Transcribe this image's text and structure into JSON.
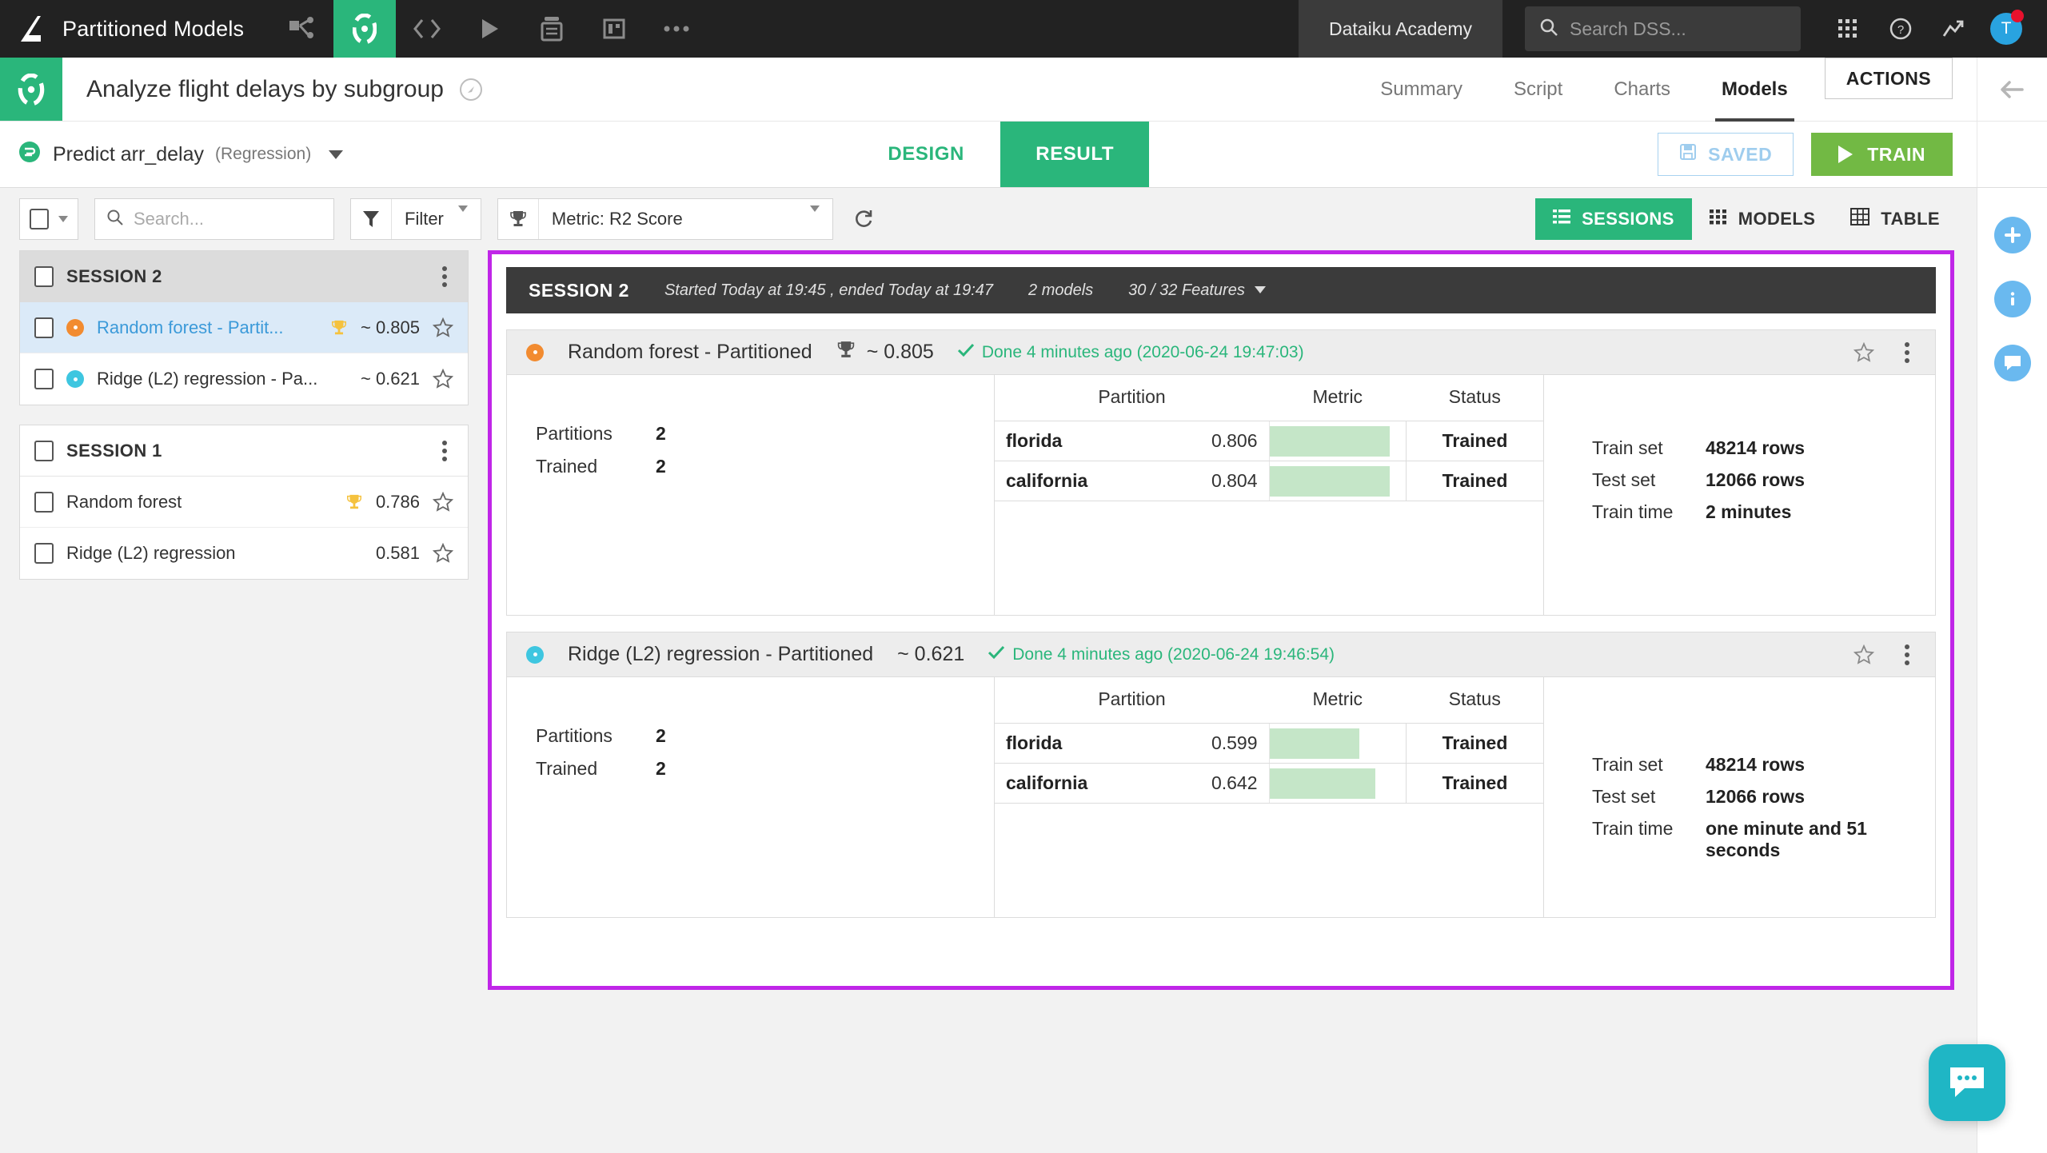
{
  "topbar": {
    "logo_icon": "dataiku-logo-icon",
    "project_name": "Partitioned Models",
    "nav_icons": [
      "flow-icon",
      "lab-icon",
      "code-icon",
      "jobs-icon",
      "notebooks-icon",
      "dashboards-icon",
      "more-icon"
    ],
    "academy_label": "Dataiku Academy",
    "search_placeholder": "Search DSS...",
    "apps_icon": "apps-grid-icon",
    "help_icon": "help-circle-icon",
    "monitoring_icon": "trending-up-icon",
    "avatar_initial": "T"
  },
  "project_header": {
    "logo_icon": "lab-circle-icon",
    "title": "Analyze flight delays by subgroup",
    "share_icon": "share-circle-icon",
    "tabs": [
      {
        "label": "Summary",
        "active": false
      },
      {
        "label": "Script",
        "active": false
      },
      {
        "label": "Charts",
        "active": false
      },
      {
        "label": "Models",
        "active": true
      }
    ],
    "actions_label": "ACTIONS",
    "collapse_icon": "arrow-left-icon"
  },
  "model_bar": {
    "icon": "prediction-icon",
    "name": "Predict arr_delay",
    "subtitle": "(Regression)",
    "dropdown_icon": "caret-down-icon",
    "tabs": [
      {
        "label": "DESIGN",
        "active": false
      },
      {
        "label": "RESULT",
        "active": true
      }
    ],
    "saved_label": "SAVED",
    "saved_icon": "floppy-disk-icon",
    "train_label": "TRAIN",
    "train_icon": "play-icon"
  },
  "toolbar": {
    "select_all_icon": "checkbox-icon",
    "select_all_caret": "caret-down-icon",
    "search_icon": "search-icon",
    "search_placeholder": "Search...",
    "filter_icon": "funnel-icon",
    "filter_label": "Filter",
    "filter_caret": "caret-down-icon",
    "metric_icon": "trophy-icon",
    "metric_label": "Metric: R2 Score",
    "metric_caret": "caret-down-icon",
    "refresh_icon": "refresh-icon",
    "views": [
      {
        "label": "SESSIONS",
        "icon": "list-icon",
        "active": true
      },
      {
        "label": "MODELS",
        "icon": "grid-icon",
        "active": false
      },
      {
        "label": "TABLE",
        "icon": "table-icon",
        "active": false
      }
    ]
  },
  "sidebar": {
    "groups": [
      {
        "title": "SESSION 2",
        "header_style": "dark",
        "kebab_icon": "kebab-menu-icon",
        "rows": [
          {
            "name": "Random forest - Partit...",
            "score": "~ 0.805",
            "dot_color": "#f28b30",
            "trophy": true,
            "selected": true,
            "star_icon": "star-outline-icon"
          },
          {
            "name": "Ridge (L2) regression - Pa...",
            "score": "~ 0.621",
            "dot_color": "#3ec6e0",
            "trophy": false,
            "selected": false,
            "star_icon": "star-outline-icon"
          }
        ]
      },
      {
        "title": "SESSION 1",
        "header_style": "light",
        "kebab_icon": "kebab-menu-icon",
        "rows": [
          {
            "name": "Random forest",
            "score": "0.786",
            "dot_color": null,
            "trophy": true,
            "selected": false,
            "star_icon": "star-outline-icon"
          },
          {
            "name": "Ridge (L2) regression",
            "score": "0.581",
            "dot_color": null,
            "trophy": false,
            "selected": false,
            "star_icon": "star-outline-icon"
          }
        ]
      }
    ]
  },
  "session_banner": {
    "title": "SESSION 2",
    "times": "Started Today at 19:45 , ended Today at 19:47",
    "models_count": "2 models",
    "features": "30 / 32 Features",
    "features_caret": "caret-down-icon"
  },
  "cards": [
    {
      "dot_color": "#f28b30",
      "name": "Random forest - Partitioned",
      "trophy": true,
      "trophy_icon": "trophy-icon",
      "score": "~ 0.805",
      "status_icon": "check-icon",
      "status": "Done 4 minutes ago (2020-06-24 19:47:03)",
      "star_icon": "star-outline-icon",
      "kebab_icon": "kebab-menu-icon",
      "summary": [
        {
          "label": "Partitions",
          "value": "2"
        },
        {
          "label": "Trained",
          "value": "2"
        }
      ],
      "table": {
        "columns": [
          "Partition",
          "Metric",
          "Status"
        ],
        "rows": [
          {
            "partition": "florida",
            "metric": "0.806",
            "bar_pct": 88,
            "status": "Trained"
          },
          {
            "partition": "california",
            "metric": "0.804",
            "bar_pct": 88,
            "status": "Trained"
          }
        ]
      },
      "info": [
        {
          "label": "Train set",
          "value": "48214 rows"
        },
        {
          "label": "Test set",
          "value": "12066 rows"
        },
        {
          "label": "Train time",
          "value": "2 minutes"
        }
      ]
    },
    {
      "dot_color": "#3ec6e0",
      "name": "Ridge (L2) regression - Partitioned",
      "trophy": false,
      "trophy_icon": "trophy-icon",
      "score": "~ 0.621",
      "status_icon": "check-icon",
      "status": "Done 4 minutes ago (2020-06-24 19:46:54)",
      "star_icon": "star-outline-icon",
      "kebab_icon": "kebab-menu-icon",
      "summary": [
        {
          "label": "Partitions",
          "value": "2"
        },
        {
          "label": "Trained",
          "value": "2"
        }
      ],
      "table": {
        "columns": [
          "Partition",
          "Metric",
          "Status"
        ],
        "rows": [
          {
            "partition": "florida",
            "metric": "0.599",
            "bar_pct": 66,
            "status": "Trained"
          },
          {
            "partition": "california",
            "metric": "0.642",
            "bar_pct": 78,
            "status": "Trained"
          }
        ]
      },
      "info": [
        {
          "label": "Train set",
          "value": "48214 rows"
        },
        {
          "label": "Test set",
          "value": "12066 rows"
        },
        {
          "label": "Train time",
          "value": "one minute and 51 seconds"
        }
      ]
    }
  ],
  "right_rail": {
    "icons": [
      "arrow-left-icon",
      "plus-circle-icon",
      "info-circle-icon",
      "comment-circle-icon"
    ]
  },
  "chat": {
    "icon": "chat-bubble-icon"
  },
  "colors": {
    "green": "#2ab67b",
    "train_green": "#72b944",
    "highlight_purple": "#c026e8",
    "dark": "#222222",
    "orange_dot": "#f28b30",
    "blue_dot": "#3ec6e0",
    "link_blue": "#3b9ad9",
    "bar_green": "#c5e6c8"
  }
}
